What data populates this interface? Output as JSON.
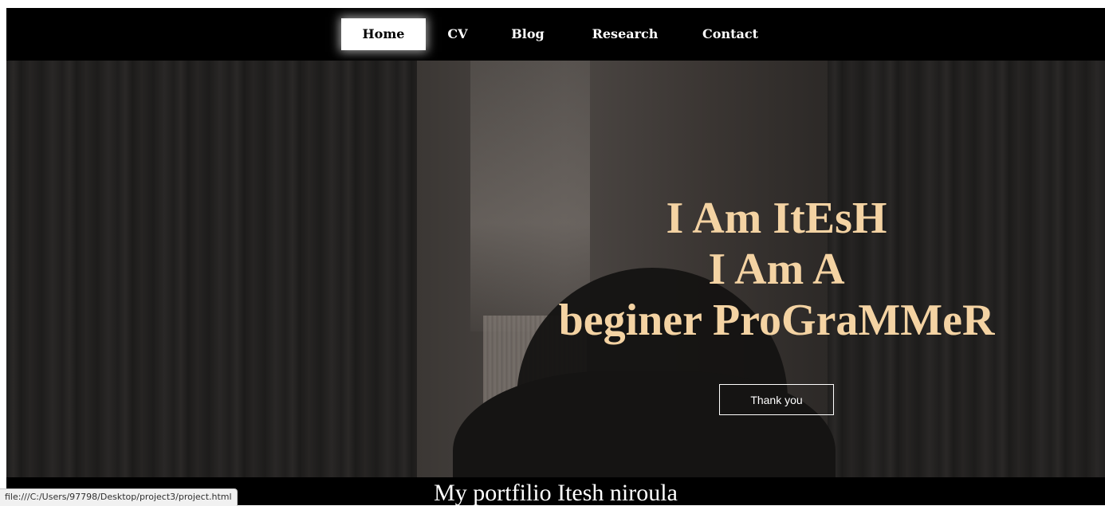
{
  "nav": {
    "items": [
      {
        "label": "Home",
        "active": true
      },
      {
        "label": "CV",
        "active": false
      },
      {
        "label": "Blog",
        "active": false
      },
      {
        "label": "Research",
        "active": false
      },
      {
        "label": "Contact",
        "active": false
      }
    ]
  },
  "hero": {
    "line1": "I Am ItEsH",
    "line2": "I Am A",
    "line3": "beginer ProGraMMeR",
    "button_label": "Thank you"
  },
  "footer": {
    "text": "My portfilio Itesh niroula"
  },
  "status_bar": {
    "url": "file:///C:/Users/97798/Desktop/project3/project.html"
  },
  "colors": {
    "accent_text": "#f4d3a3",
    "nav_background": "#000000",
    "active_tab_background": "#ffffff"
  }
}
